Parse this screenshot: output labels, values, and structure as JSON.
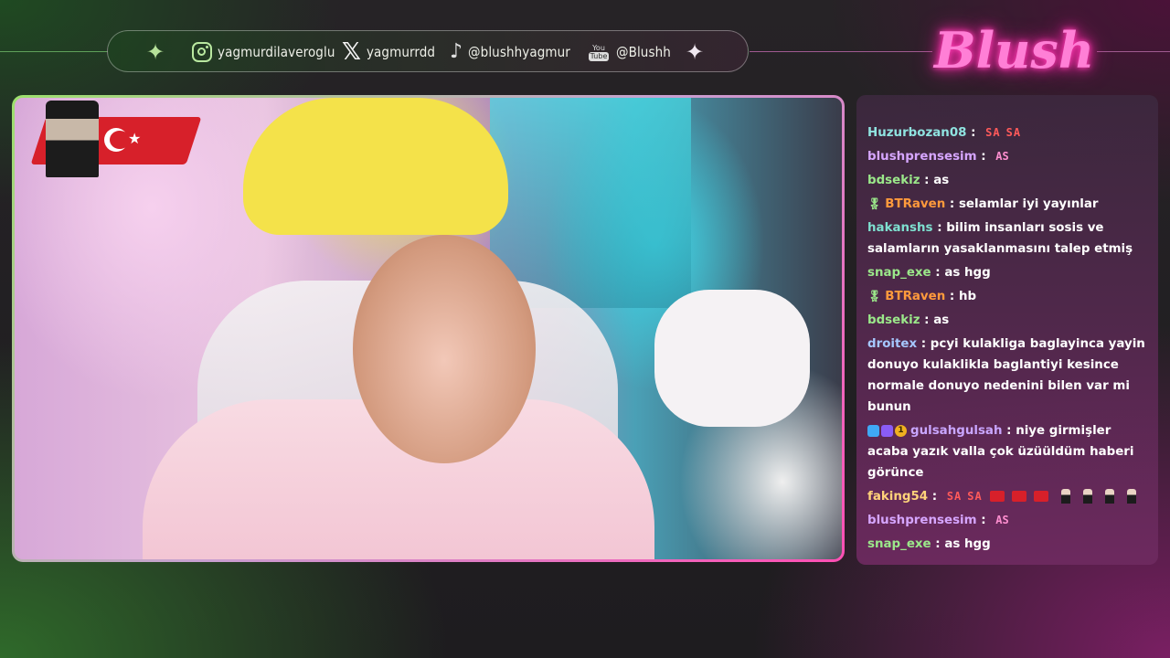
{
  "socials": {
    "instagram": "yagmurdilaveroglu",
    "x": "yagmurrdd",
    "tiktok": "@blushhyagmur",
    "youtube_icon_top": "You",
    "youtube_icon_bottom": "Tube",
    "youtube": "@Blushh"
  },
  "brand": {
    "logo": "Blush"
  },
  "chat": [
    {
      "user": "Huzurbozan08",
      "color": "#8fe3e0",
      "text": "",
      "emotes": [
        "SA",
        "SA"
      ]
    },
    {
      "user": "blushprensesim",
      "color": "#d6a6ff",
      "text": "",
      "emotes_as": [
        "AS"
      ]
    },
    {
      "user": "bdsekiz",
      "color": "#9be88a",
      "text": "as"
    },
    {
      "user": "BTRaven",
      "color": "#ff9a3c",
      "badge": "🎖",
      "text": "selamlar iyi yayınlar"
    },
    {
      "user": "hakanshs",
      "color": "#7ee0d0",
      "text": "bilim insanları sosis ve salamların yasaklanmasını talep etmiş"
    },
    {
      "user": "snap_exe",
      "color": "#9be88a",
      "text": "as hgg"
    },
    {
      "user": "BTRaven",
      "color": "#ff9a3c",
      "badge": "🎖",
      "text": "hb"
    },
    {
      "user": "bdsekiz",
      "color": "#9be88a",
      "text": "as"
    },
    {
      "user": "droitex",
      "color": "#a6c8ff",
      "text": "pcyi kulakliga baglayinca yayin donuyo kulaklikla baglantiyi kesince normale donuyo nedenini bilen var mi bunun"
    },
    {
      "user": "gulsahgulsah",
      "color": "#c9a6ff",
      "text": "niye girmişler acaba yazık valla çok üzüüldüm haberi görünce",
      "multi_badge": true,
      "gold_badge": "1"
    },
    {
      "user": "faking54",
      "color": "#ffd27a",
      "text": "",
      "emotes": [
        "SA",
        "SA"
      ],
      "flags": 3,
      "persons": 4
    },
    {
      "user": "blushprensesim",
      "color": "#d6a6ff",
      "text": "",
      "emotes_as": [
        "AS"
      ]
    },
    {
      "user": "snap_exe",
      "color": "#9be88a",
      "text": "as hgg"
    }
  ],
  "colors": {
    "accent_green": "#9de06d",
    "accent_pink": "#ff4fb4",
    "logo_pink": "#ff7fd6"
  }
}
